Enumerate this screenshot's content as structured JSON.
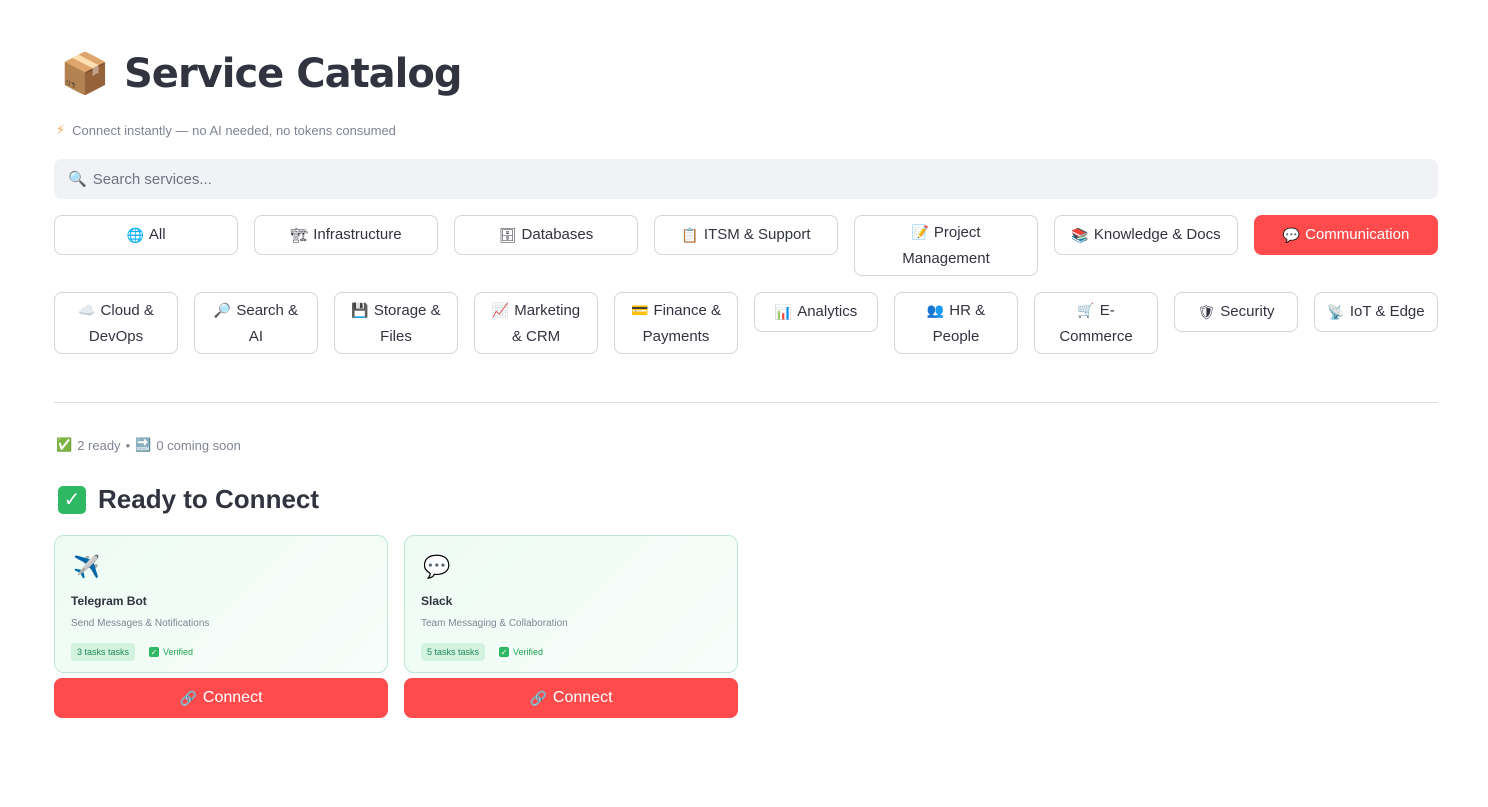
{
  "header": {
    "icon": "package-icon",
    "title": "Service Catalog",
    "subtitle_icon": "bolt-icon",
    "subtitle": "Connect instantly — no AI needed, no tokens consumed"
  },
  "search": {
    "icon": "search-icon",
    "placeholder": "Search services...",
    "value": ""
  },
  "categories": [
    {
      "label": "All",
      "icon": "globe-icon",
      "active": false
    },
    {
      "label": "Infrastructure",
      "icon": "construction-icon",
      "active": false
    },
    {
      "label": "Databases",
      "icon": "database-icon",
      "active": false
    },
    {
      "label": "ITSM & Support",
      "icon": "clipboard-icon",
      "active": false
    },
    {
      "label": "Project Management",
      "icon": "memo-icon",
      "active": false
    },
    {
      "label": "Knowledge & Docs",
      "icon": "books-icon",
      "active": false
    },
    {
      "label": "Communication",
      "icon": "speech-bubble-icon",
      "active": true
    },
    {
      "label": "Cloud & DevOps",
      "icon": "cloud-icon",
      "active": false
    },
    {
      "label": "Search & AI",
      "icon": "magnifier-icon",
      "active": false
    },
    {
      "label": "Storage & Files",
      "icon": "floppy-disk-icon",
      "active": false
    },
    {
      "label": "Marketing & CRM",
      "icon": "chart-up-icon",
      "active": false
    },
    {
      "label": "Finance & Payments",
      "icon": "credit-card-icon",
      "active": false
    },
    {
      "label": "Analytics",
      "icon": "bar-chart-icon",
      "active": false
    },
    {
      "label": "HR & People",
      "icon": "people-icon",
      "active": false
    },
    {
      "label": "E-Commerce",
      "icon": "cart-icon",
      "active": false
    },
    {
      "label": "Security",
      "icon": "shield-icon",
      "active": false
    },
    {
      "label": "IoT & Edge",
      "icon": "satellite-icon",
      "active": false
    }
  ],
  "stats": {
    "ready_icon": "check-icon",
    "ready": "2 ready",
    "separator": "•",
    "soon_icon": "soon-arrow-icon",
    "soon": "0 coming soon"
  },
  "section": {
    "icon": "check-box-icon",
    "title": "Ready to Connect"
  },
  "services": [
    {
      "name": "Telegram Bot",
      "icon": "airplane-icon",
      "description": "Send Messages & Notifications",
      "tasks": "3 tasks tasks",
      "verified": "Verified",
      "button": "Connect",
      "button_icon": "link-icon"
    },
    {
      "name": "Slack",
      "icon": "speech-bubble-icon",
      "description": "Team Messaging & Collaboration",
      "tasks": "5 tasks tasks",
      "verified": "Verified",
      "button": "Connect",
      "button_icon": "link-icon"
    }
  ],
  "colors": {
    "accent": "#ff4b4b",
    "success": "#2fb864",
    "card_border": "#bfe8d3"
  }
}
